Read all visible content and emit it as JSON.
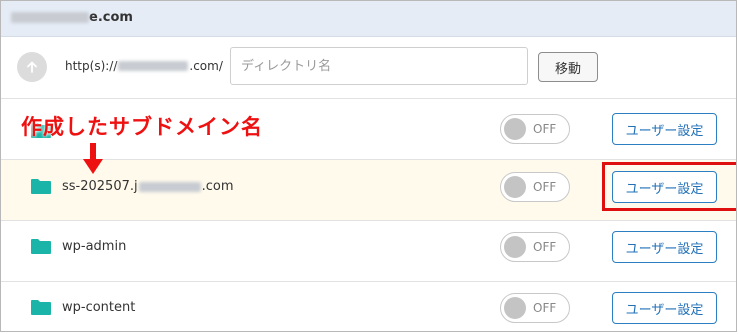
{
  "header": {
    "host_suffix": "e.com"
  },
  "path_row": {
    "url_prefix": "http(s)://",
    "url_suffix": ".com/",
    "directory_placeholder": "ディレクトリ名",
    "move_label": "移動"
  },
  "annotation": {
    "text": "作成したサブドメイン名"
  },
  "rows": [
    {
      "name": "",
      "toggle": "OFF",
      "button": "ユーザー設定"
    },
    {
      "name_prefix": "ss-202507.j",
      "name_suffix": ".com",
      "toggle": "OFF",
      "button": "ユーザー設定"
    },
    {
      "name": "wp-admin",
      "toggle": "OFF",
      "button": "ユーザー設定"
    },
    {
      "name": "wp-content",
      "toggle": "OFF",
      "button": "ユーザー設定"
    }
  ],
  "colors": {
    "accent": "#2170b8",
    "folder": "#1ab5a8",
    "annotation": "#ee1111",
    "highlight_row": "#fffaec",
    "header_bg": "#e5ecf6"
  },
  "icons": [
    "arrow-up-icon",
    "folder-icon",
    "arrow-down-icon"
  ]
}
